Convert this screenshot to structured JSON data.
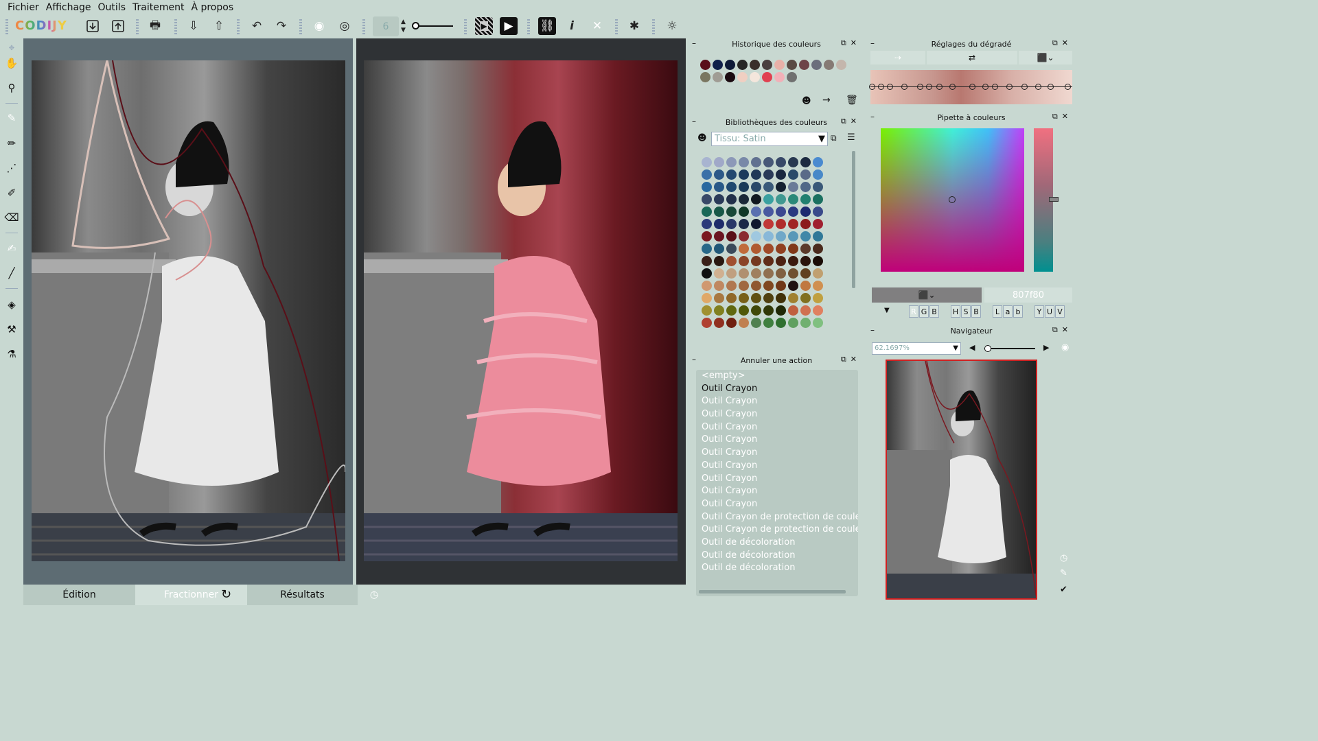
{
  "menu": [
    "Fichier",
    "Affichage",
    "Outils",
    "Traitement",
    "À propos"
  ],
  "logo": "CODIJY",
  "toolbar": {
    "brush_size": "6"
  },
  "bottom_tabs": {
    "edition": "Édition",
    "fractionner": "Fractionner",
    "resultats": "Résultats"
  },
  "history_panel": {
    "title": "Historique des couleurs",
    "colors": [
      "#5a0f1a",
      "#0f1f4a",
      "#0d1a38",
      "#262626",
      "#3a2e2a",
      "#4a3f3f",
      "#e8b0a8",
      "#5a4a44",
      "#6e4348",
      "#6b6e7c",
      "#867a74",
      "#c4b6ac",
      "#7a7660",
      "#a09c94",
      "#1a0a10",
      "#f0cfc2",
      "#f4e6dc",
      "#e04050",
      "#f2b0b8",
      "#707070"
    ]
  },
  "library_panel": {
    "title": "Bibliothèques des couleurs",
    "selected": "Tissu: Satin",
    "rows": [
      [
        "#a8b4d0",
        "#a0a8c8",
        "#8c98b8",
        "#7888a8",
        "#607090",
        "#485878",
        "#384868",
        "#283850",
        "#1c2a40",
        "#4a8ad0"
      ],
      [
        "#3a70a8",
        "#2c5888",
        "#244870",
        "#1c3a5c",
        "#203858",
        "#2a3a58",
        "#1a2840",
        "#2a4a6a",
        "#5a6a88",
        "#4888c8"
      ],
      [
        "#2868a0",
        "#285888",
        "#204870",
        "#1a3a58",
        "#2a4868",
        "#3a5a7a",
        "#142030",
        "#6a7a98",
        "#506888",
        "#3a5878"
      ],
      [
        "#384868",
        "#2a3a58",
        "#22304a",
        "#1a2838",
        "#101820",
        "#3aa0a0",
        "#409890",
        "#2a8878",
        "#208070",
        "#1a7060"
      ],
      [
        "#1a6858",
        "#185848",
        "#184838",
        "#103828",
        "#5a70b0",
        "#4858a0",
        "#3a4890",
        "#2a3880",
        "#1c2a70",
        "#3a4a8a"
      ],
      [
        "#2c3a7a",
        "#1e2c6a",
        "#283868",
        "#1a2848",
        "#101830",
        "#c03838",
        "#b02c2c",
        "#a02424",
        "#8c1c1c",
        "#a02030"
      ],
      [
        "#7a1820",
        "#6a1420",
        "#5a1018",
        "#8a2a30",
        "#a0c8e0",
        "#88b8d8",
        "#70a8c8",
        "#5898b8",
        "#4088a8",
        "#307898"
      ],
      [
        "#286888",
        "#205878",
        "#3a4a5a",
        "#c06a3a",
        "#b05a30",
        "#a04a28",
        "#904020",
        "#803818",
        "#5a3a2a",
        "#4a2a1c"
      ],
      [
        "#3a2018",
        "#2a1810",
        "#a05030",
        "#8a4428",
        "#743820",
        "#602c18",
        "#4c2212",
        "#3a1a0e",
        "#2a140c",
        "#1a0c06"
      ],
      [
        "#101010",
        "#d0b090",
        "#c0a080",
        "#b09070",
        "#a08060",
        "#907050",
        "#806040",
        "#705030",
        "#604020",
        "#c0a070"
      ],
      [
        "#d09870",
        "#c08860",
        "#b07850",
        "#a06840",
        "#905830",
        "#804820",
        "#703818",
        "#201010",
        "#c07840",
        "#d09050"
      ],
      [
        "#e0a868",
        "#a87840",
        "#906828",
        "#786018",
        "#605010",
        "#504010",
        "#403008",
        "#a08030",
        "#807020",
        "#c0a040"
      ],
      [
        "#a09030",
        "#808020",
        "#606810",
        "#505808",
        "#404808",
        "#303808",
        "#202806",
        "#c06040",
        "#d07050",
        "#e08060"
      ],
      [
        "#b04030",
        "#903020",
        "#702010",
        "#c08050",
        "#508050",
        "#408040",
        "#307030",
        "#60a060",
        "#70b070",
        "#80c080"
      ]
    ]
  },
  "undo_panel": {
    "title": "Annuler une action",
    "items": [
      "<empty>",
      "Outil Crayon",
      "Outil Crayon",
      "Outil Crayon",
      "Outil Crayon",
      "Outil Crayon",
      "Outil Crayon",
      "Outil Crayon",
      "Outil Crayon",
      "Outil Crayon",
      "Outil Crayon",
      "Outil Crayon de protection de coule",
      "Outil Crayon de protection de coule",
      "Outil de décoloration",
      "Outil de décoloration",
      "Outil de décoloration"
    ]
  },
  "gradient_panel": {
    "title": "Réglages du dégradé"
  },
  "picker_panel": {
    "title": "Pipette à couleurs",
    "hex": "807f80",
    "modes": [
      "R",
      "G",
      "B",
      "H",
      "S",
      "B",
      "L",
      "a",
      "b",
      "Y",
      "U",
      "V"
    ]
  },
  "navigator_panel": {
    "title": "Navigateur",
    "zoom": "62.1697%"
  }
}
